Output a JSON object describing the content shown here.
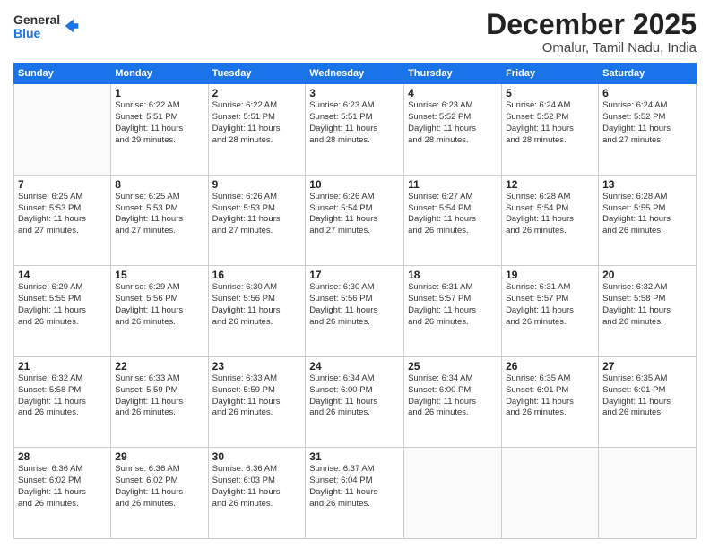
{
  "logo": {
    "general": "General",
    "blue": "Blue"
  },
  "header": {
    "month": "December 2025",
    "location": "Omalur, Tamil Nadu, India"
  },
  "weekdays": [
    "Sunday",
    "Monday",
    "Tuesday",
    "Wednesday",
    "Thursday",
    "Friday",
    "Saturday"
  ],
  "weeks": [
    [
      {
        "day": "",
        "info": ""
      },
      {
        "day": "1",
        "info": "Sunrise: 6:22 AM\nSunset: 5:51 PM\nDaylight: 11 hours\nand 29 minutes."
      },
      {
        "day": "2",
        "info": "Sunrise: 6:22 AM\nSunset: 5:51 PM\nDaylight: 11 hours\nand 28 minutes."
      },
      {
        "day": "3",
        "info": "Sunrise: 6:23 AM\nSunset: 5:51 PM\nDaylight: 11 hours\nand 28 minutes."
      },
      {
        "day": "4",
        "info": "Sunrise: 6:23 AM\nSunset: 5:52 PM\nDaylight: 11 hours\nand 28 minutes."
      },
      {
        "day": "5",
        "info": "Sunrise: 6:24 AM\nSunset: 5:52 PM\nDaylight: 11 hours\nand 28 minutes."
      },
      {
        "day": "6",
        "info": "Sunrise: 6:24 AM\nSunset: 5:52 PM\nDaylight: 11 hours\nand 27 minutes."
      }
    ],
    [
      {
        "day": "7",
        "info": "Sunrise: 6:25 AM\nSunset: 5:53 PM\nDaylight: 11 hours\nand 27 minutes."
      },
      {
        "day": "8",
        "info": "Sunrise: 6:25 AM\nSunset: 5:53 PM\nDaylight: 11 hours\nand 27 minutes."
      },
      {
        "day": "9",
        "info": "Sunrise: 6:26 AM\nSunset: 5:53 PM\nDaylight: 11 hours\nand 27 minutes."
      },
      {
        "day": "10",
        "info": "Sunrise: 6:26 AM\nSunset: 5:54 PM\nDaylight: 11 hours\nand 27 minutes."
      },
      {
        "day": "11",
        "info": "Sunrise: 6:27 AM\nSunset: 5:54 PM\nDaylight: 11 hours\nand 26 minutes."
      },
      {
        "day": "12",
        "info": "Sunrise: 6:28 AM\nSunset: 5:54 PM\nDaylight: 11 hours\nand 26 minutes."
      },
      {
        "day": "13",
        "info": "Sunrise: 6:28 AM\nSunset: 5:55 PM\nDaylight: 11 hours\nand 26 minutes."
      }
    ],
    [
      {
        "day": "14",
        "info": "Sunrise: 6:29 AM\nSunset: 5:55 PM\nDaylight: 11 hours\nand 26 minutes."
      },
      {
        "day": "15",
        "info": "Sunrise: 6:29 AM\nSunset: 5:56 PM\nDaylight: 11 hours\nand 26 minutes."
      },
      {
        "day": "16",
        "info": "Sunrise: 6:30 AM\nSunset: 5:56 PM\nDaylight: 11 hours\nand 26 minutes."
      },
      {
        "day": "17",
        "info": "Sunrise: 6:30 AM\nSunset: 5:56 PM\nDaylight: 11 hours\nand 26 minutes."
      },
      {
        "day": "18",
        "info": "Sunrise: 6:31 AM\nSunset: 5:57 PM\nDaylight: 11 hours\nand 26 minutes."
      },
      {
        "day": "19",
        "info": "Sunrise: 6:31 AM\nSunset: 5:57 PM\nDaylight: 11 hours\nand 26 minutes."
      },
      {
        "day": "20",
        "info": "Sunrise: 6:32 AM\nSunset: 5:58 PM\nDaylight: 11 hours\nand 26 minutes."
      }
    ],
    [
      {
        "day": "21",
        "info": "Sunrise: 6:32 AM\nSunset: 5:58 PM\nDaylight: 11 hours\nand 26 minutes."
      },
      {
        "day": "22",
        "info": "Sunrise: 6:33 AM\nSunset: 5:59 PM\nDaylight: 11 hours\nand 26 minutes."
      },
      {
        "day": "23",
        "info": "Sunrise: 6:33 AM\nSunset: 5:59 PM\nDaylight: 11 hours\nand 26 minutes."
      },
      {
        "day": "24",
        "info": "Sunrise: 6:34 AM\nSunset: 6:00 PM\nDaylight: 11 hours\nand 26 minutes."
      },
      {
        "day": "25",
        "info": "Sunrise: 6:34 AM\nSunset: 6:00 PM\nDaylight: 11 hours\nand 26 minutes."
      },
      {
        "day": "26",
        "info": "Sunrise: 6:35 AM\nSunset: 6:01 PM\nDaylight: 11 hours\nand 26 minutes."
      },
      {
        "day": "27",
        "info": "Sunrise: 6:35 AM\nSunset: 6:01 PM\nDaylight: 11 hours\nand 26 minutes."
      }
    ],
    [
      {
        "day": "28",
        "info": "Sunrise: 6:36 AM\nSunset: 6:02 PM\nDaylight: 11 hours\nand 26 minutes."
      },
      {
        "day": "29",
        "info": "Sunrise: 6:36 AM\nSunset: 6:02 PM\nDaylight: 11 hours\nand 26 minutes."
      },
      {
        "day": "30",
        "info": "Sunrise: 6:36 AM\nSunset: 6:03 PM\nDaylight: 11 hours\nand 26 minutes."
      },
      {
        "day": "31",
        "info": "Sunrise: 6:37 AM\nSunset: 6:04 PM\nDaylight: 11 hours\nand 26 minutes."
      },
      {
        "day": "",
        "info": ""
      },
      {
        "day": "",
        "info": ""
      },
      {
        "day": "",
        "info": ""
      }
    ]
  ]
}
